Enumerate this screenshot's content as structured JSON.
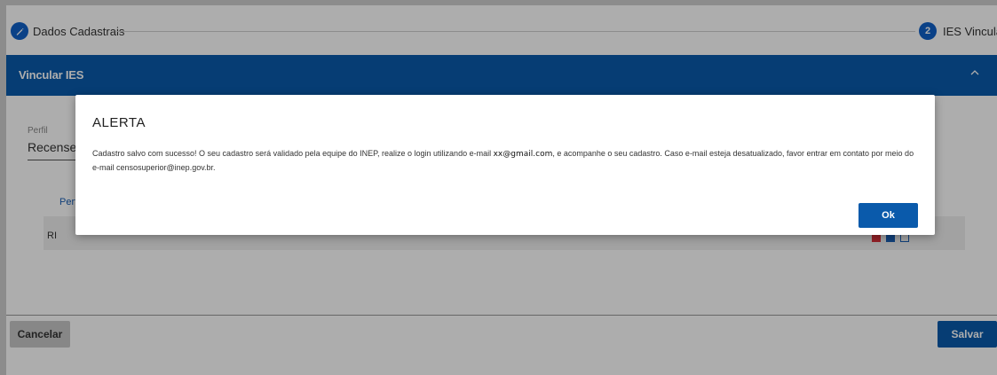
{
  "stepper": {
    "step1_label": "Dados Cadastrais",
    "step2_number": "2",
    "step2_label": "IES Vinculada"
  },
  "panel": {
    "title": "Vincular IES",
    "chevron_icon": "chevron-up-icon"
  },
  "form": {
    "field_label": "Perfil",
    "field_value": "Recensea",
    "column_header": "Perf",
    "row_cell": "RI"
  },
  "footer": {
    "cancel_label": "Cancelar",
    "save_label": "Salvar"
  },
  "modal": {
    "title": "ALERTA",
    "message_part1": "Cadastro salvo com sucesso! O seu cadastro será validado pela equipe do INEP, realize o login utilizando e-mail",
    "email": "xx@gmail.com",
    "message_part2": ", e acompanhe o seu cadastro. Caso e-mail esteja desatualizado, favor entrar em contato por meio do e-mail censosuperior@inep.gov.br.",
    "ok_label": "Ok"
  },
  "colors": {
    "primary": "#0a5aab",
    "step_circle": "#1060c8",
    "action_red": "#d9303a",
    "action_blue": "#1a5fb4"
  }
}
